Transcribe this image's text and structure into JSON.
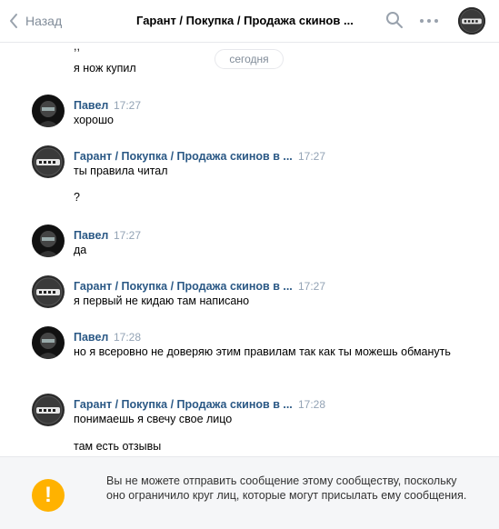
{
  "header": {
    "back_label": "Назад",
    "title": "Гарант / Покупка / Продажа скинов ...",
    "icons": [
      "chevron-left-icon",
      "search-icon",
      "more-icon"
    ]
  },
  "date_divider": "сегодня",
  "top_fragment": {
    "quote": ",,",
    "text": "я нож купил"
  },
  "messages": [
    {
      "author": "Павел",
      "time": "17:27",
      "lines": [
        "хорошо"
      ]
    },
    {
      "author": "Гарант / Покупка / Продажа скинов в ...",
      "time": "17:27",
      "lines": [
        "ты правила читал",
        "?"
      ]
    },
    {
      "author": "Павел",
      "time": "17:27",
      "lines": [
        "да"
      ]
    },
    {
      "author": "Гарант / Покупка / Продажа скинов в ...",
      "time": "17:27",
      "lines": [
        "я первый не кидаю там написано"
      ]
    },
    {
      "author": "Павел",
      "time": "17:28",
      "lines": [
        "но я всеровно не доверяю этим правилам так как ты можешь обмануть"
      ]
    },
    {
      "author": "Гарант / Покупка / Продажа скинов в ...",
      "time": "17:28",
      "lines": [
        "понимаешь я свечу свое лицо",
        "там есть отзывы"
      ]
    }
  ],
  "footer": {
    "icon_glyph": "!",
    "notice": "Вы не можете отправить сообщение этому сообществу, поскольку оно ограничило круг лиц, которые могут присылать ему сообщения."
  },
  "colors": {
    "link": "#2a5885",
    "muted": "#818c99",
    "warning": "#ffb200"
  }
}
